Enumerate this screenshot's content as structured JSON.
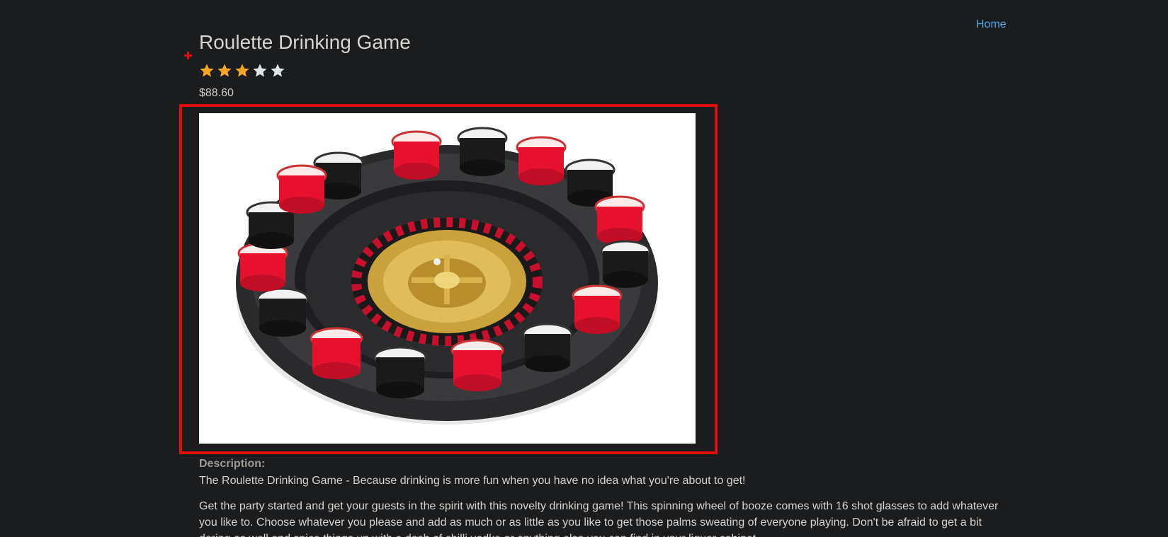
{
  "nav": {
    "home_label": "Home"
  },
  "product": {
    "title": "Roulette Drinking Game",
    "rating": 3,
    "rating_max": 5,
    "price": "$88.60",
    "image_alt": "roulette-drinking-game-photo"
  },
  "description": {
    "label": "Description:",
    "tagline": "The Roulette Drinking Game - Because drinking is more fun when you have no idea what you're about to get!",
    "body": "Get the party started and get your guests in the spirit with this novelty drinking game! This spinning wheel of booze comes with 16 shot glasses to add whatever you like to. Choose whatever you please and add as much or as little as you like to get those palms sweating of everyone playing. Don't be afraid to get a bit daring as well and spice things up with a dash of chilli vodka or anything else you can find in your liquor cabinet."
  },
  "colors": {
    "background": "#1b1c1e",
    "link": "#4aa8e8",
    "highlight_border": "#e00d0d",
    "star_filled": "#f5a623",
    "star_empty": "#dfe6ea"
  },
  "icons": {
    "star": "star-icon",
    "cursor": "crosshair-cursor-icon"
  }
}
